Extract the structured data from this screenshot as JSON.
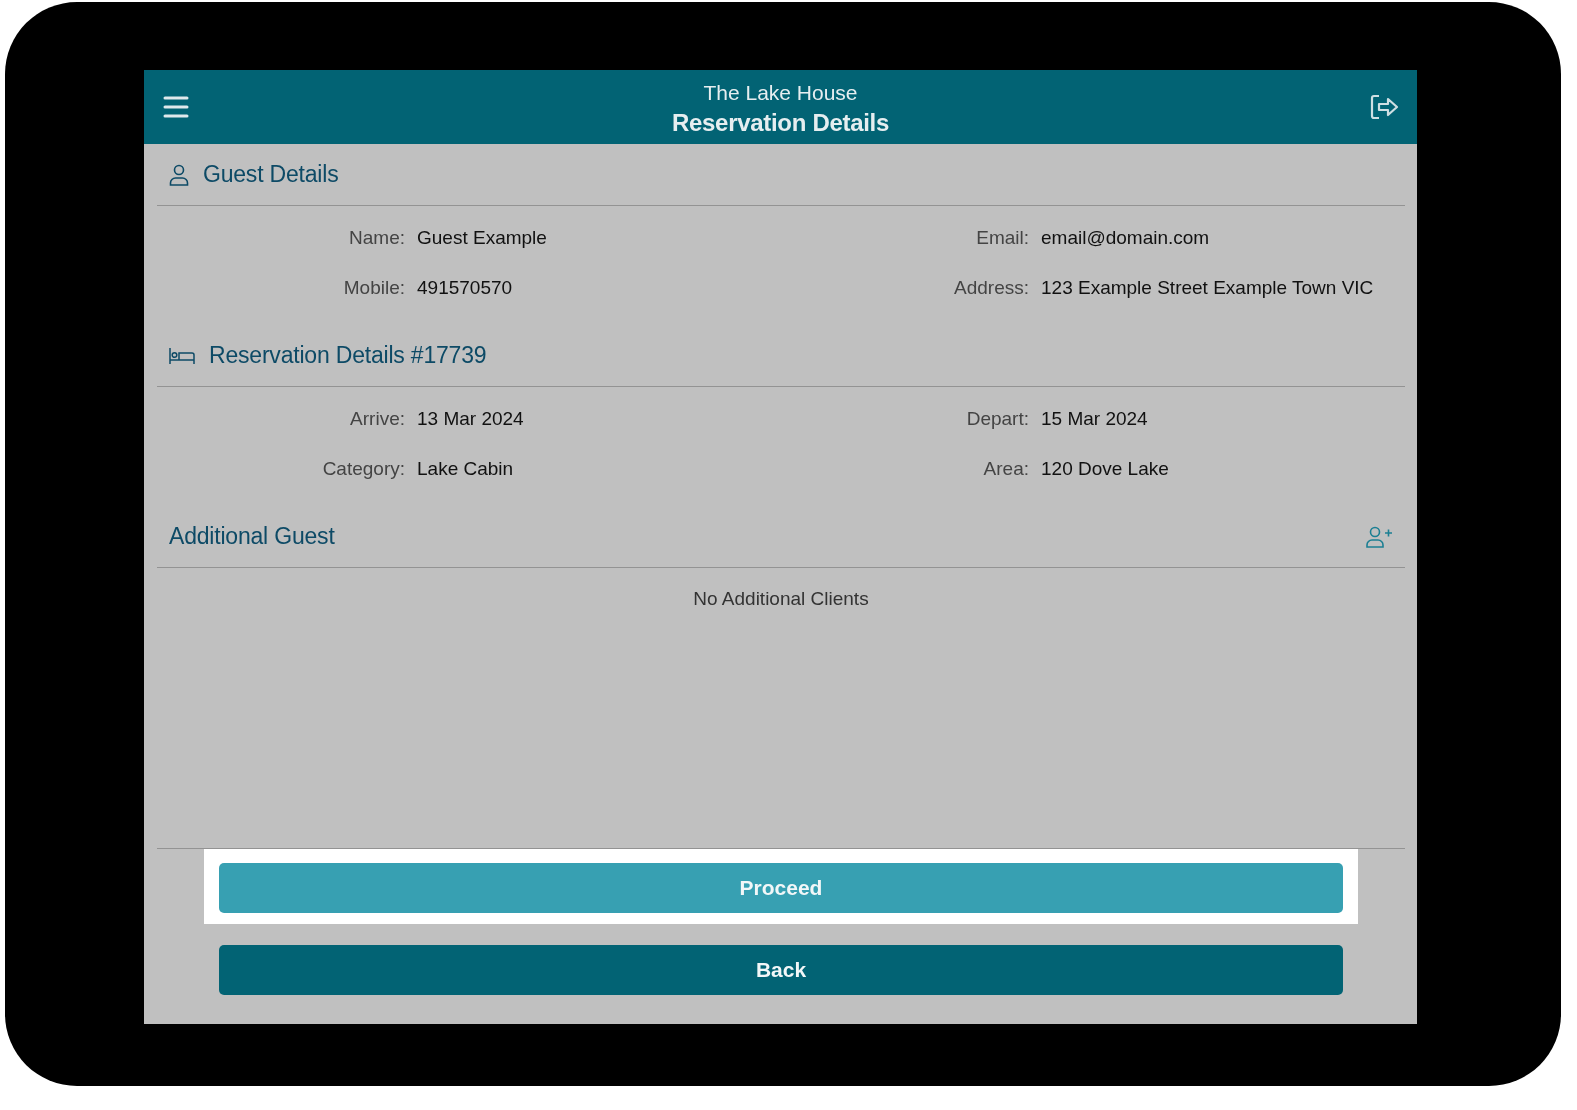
{
  "header": {
    "subtitle": "The Lake House",
    "title": "Reservation Details"
  },
  "sections": [
    {
      "kind": "guest",
      "title": "Guest Details",
      "fields": [
        {
          "label": "Name:",
          "value": "Guest Example"
        },
        {
          "label": "Email:",
          "value": "email@domain.com"
        },
        {
          "label": "Mobile:",
          "value": "491570570"
        },
        {
          "label": "Address:",
          "value": "123 Example Street Example Town VIC"
        }
      ]
    },
    {
      "kind": "reservation",
      "title": "Reservation Details #17739",
      "fields": [
        {
          "label": "Arrive:",
          "value": "13 Mar 2024"
        },
        {
          "label": "Depart:",
          "value": "15 Mar 2024"
        },
        {
          "label": "Category:",
          "value": "Lake Cabin"
        },
        {
          "label": "Area:",
          "value": "120 Dove Lake"
        }
      ]
    },
    {
      "kind": "additional",
      "title": "Additional Guest",
      "empty_text": "No Additional Clients"
    }
  ],
  "buttons": [
    {
      "label": "Proceed",
      "kind": "primary",
      "highlighted": true
    },
    {
      "label": "Back",
      "kind": "secondary",
      "highlighted": false
    }
  ]
}
